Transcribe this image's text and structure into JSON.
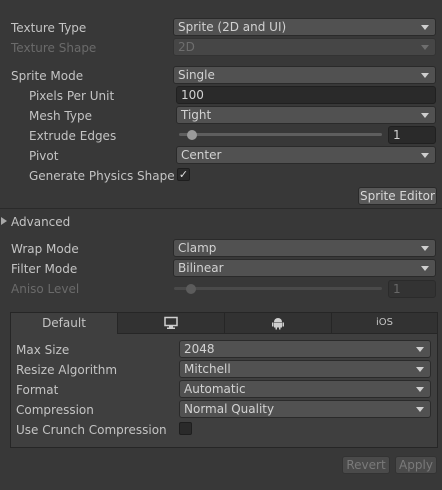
{
  "importer": {
    "texture_type": {
      "label": "Texture Type",
      "value": "Sprite (2D and UI)"
    },
    "texture_shape": {
      "label": "Texture Shape",
      "value": "2D"
    },
    "sprite_mode": {
      "label": "Sprite Mode",
      "value": "Single"
    },
    "pixels_per_unit": {
      "label": "Pixels Per Unit",
      "value": "100"
    },
    "mesh_type": {
      "label": "Mesh Type",
      "value": "Tight"
    },
    "extrude_edges": {
      "label": "Extrude Edges",
      "value": "1",
      "slider_fraction": 0.04
    },
    "pivot": {
      "label": "Pivot",
      "value": "Center"
    },
    "generate_physics_shape": {
      "label": "Generate Physics Shape",
      "checked": true,
      "check_glyph": "✓"
    },
    "sprite_editor_button": "Sprite Editor",
    "advanced_foldout": "Advanced",
    "wrap_mode": {
      "label": "Wrap Mode",
      "value": "Clamp"
    },
    "filter_mode": {
      "label": "Filter Mode",
      "value": "Bilinear"
    },
    "aniso_level": {
      "label": "Aniso Level",
      "value": "1",
      "slider_fraction": 0.06
    }
  },
  "platform_tabs": {
    "tabs": [
      {
        "label": "Default",
        "icon": "default-tab",
        "active": true
      },
      {
        "label": "",
        "icon": "monitor-icon",
        "active": false
      },
      {
        "label": "",
        "icon": "android-icon",
        "active": false
      },
      {
        "label": "iOS",
        "icon": "ios-tab",
        "active": false
      }
    ]
  },
  "platform_settings": {
    "max_size": {
      "label": "Max Size",
      "value": "2048"
    },
    "resize_algorithm": {
      "label": "Resize Algorithm",
      "value": "Mitchell"
    },
    "format": {
      "label": "Format",
      "value": "Automatic"
    },
    "compression": {
      "label": "Compression",
      "value": "Normal Quality"
    },
    "use_crunch_compression": {
      "label": "Use Crunch Compression",
      "checked": false
    }
  },
  "footer": {
    "revert_button": "Revert",
    "apply_button": "Apply"
  },
  "colors": {
    "background": "#383838",
    "field_dark": "#2a2a2a",
    "dropdown": "#515151",
    "text": "#c4c4c4",
    "disabled_text": "#6a6a6a"
  }
}
